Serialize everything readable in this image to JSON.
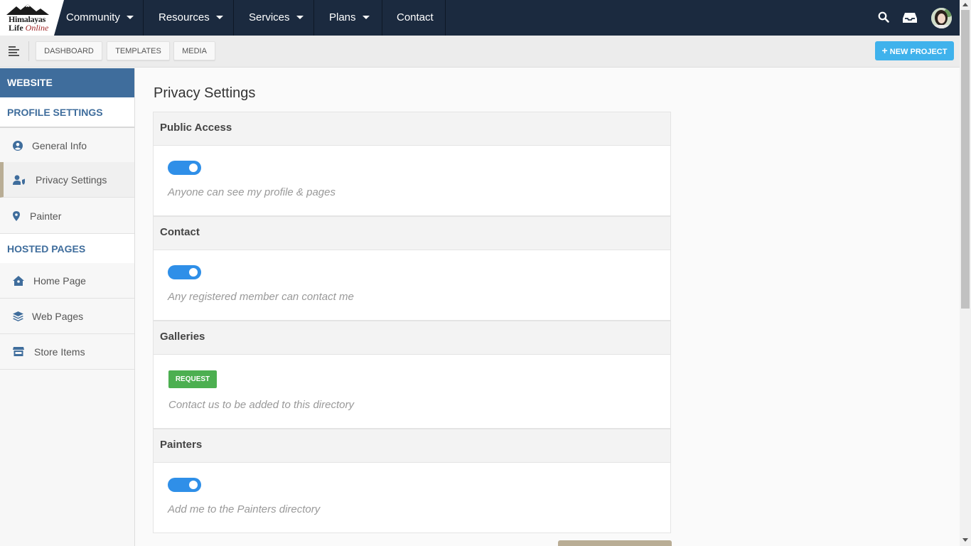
{
  "logo": {
    "line1": "Himalayas",
    "line2_a": "Life",
    "line2_b": "Online"
  },
  "nav": [
    {
      "label": "Community"
    },
    {
      "label": "Resources"
    },
    {
      "label": "Services"
    },
    {
      "label": "Plans"
    },
    {
      "label": "Contact"
    }
  ],
  "toolbar": {
    "buttons": [
      "DASHBOARD",
      "TEMPLATES",
      "MEDIA"
    ],
    "new_project": "NEW PROJECT"
  },
  "sidebar": {
    "header": "WEBSITE",
    "section1": "PROFILE SETTINGS",
    "section2": "HOSTED PAGES",
    "items": [
      {
        "label": "General Info",
        "icon": "user-circle-icon"
      },
      {
        "label": "Privacy Settings",
        "icon": "user-shield-icon"
      },
      {
        "label": "Painter",
        "icon": "map-marker-icon"
      },
      {
        "label": "Home Page",
        "icon": "home-icon"
      },
      {
        "label": "Web Pages",
        "icon": "layers-icon"
      },
      {
        "label": "Store Items",
        "icon": "store-icon"
      }
    ]
  },
  "main": {
    "title": "Privacy Settings",
    "sections": [
      {
        "heading": "Public Access",
        "description": "Anyone can see my profile & pages",
        "enabled": true
      },
      {
        "heading": "Contact",
        "description": "Any registered member can contact me",
        "enabled": true
      },
      {
        "heading": "Galleries",
        "description": "Contact us to be added to this directory",
        "action": "REQUEST"
      },
      {
        "heading": "Painters",
        "description": "Add me to the Painters directory",
        "enabled": true
      }
    ]
  },
  "colors": {
    "nav_bg": "#1b2a3f",
    "accent_blue": "#3f6d9c",
    "toggle_on": "#2f8fe8",
    "request_green": "#4caf50",
    "new_project": "#3fb2ec"
  }
}
